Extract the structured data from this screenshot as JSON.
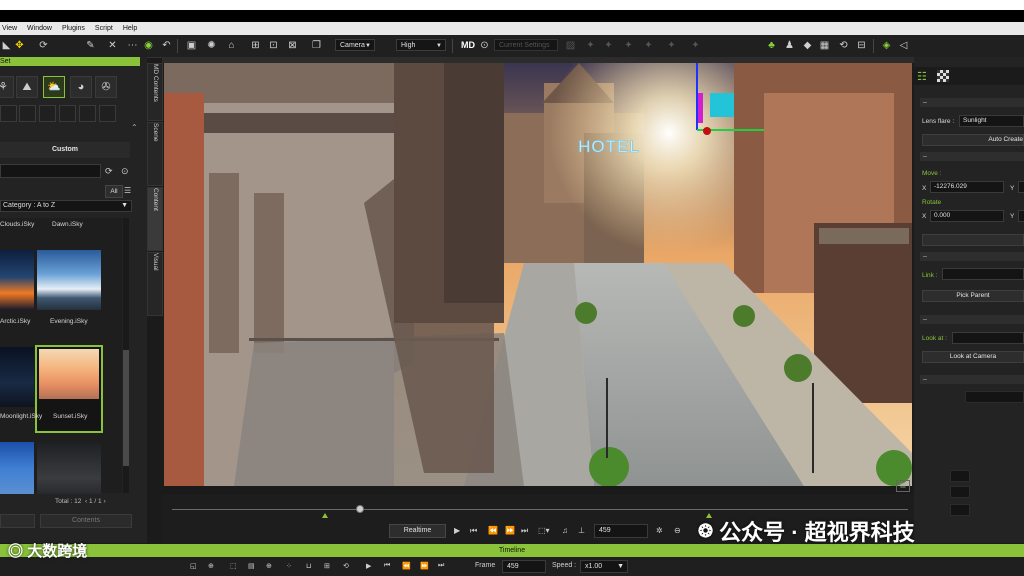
{
  "menu": [
    "View",
    "Window",
    "Plugins",
    "Script",
    "Help"
  ],
  "toolbar": {
    "camera_select": "Camera",
    "quality_select": "High",
    "ghost_select": "Current Settings"
  },
  "left_panel": {
    "header": "Set",
    "custom_label": "Custom",
    "all_label": "All",
    "category_select": "Category : A to Z",
    "items": [
      {
        "label": "Clouds.iSky"
      },
      {
        "label": "Dawn.iSky"
      },
      {
        "label": "Arctic.iSky"
      },
      {
        "label": "Evening.iSky"
      },
      {
        "label": "Moonlight.iSky"
      },
      {
        "label": "Sunset.iSky"
      }
    ],
    "total": "Total : 12",
    "page": "1 / 1",
    "btn_left": "",
    "btn_right": "Contents"
  },
  "side_tabs": [
    "MD Contents",
    "Scene",
    "Content",
    "Visual"
  ],
  "right_panel": {
    "lens_flare_label": "Lens flare :",
    "lens_flare_value": "Sunlight",
    "auto_create": "Auto Create",
    "move_label": "Move :",
    "move_x": "-12276.029",
    "rotate_label": "Rotate",
    "rotate_x": "0.000",
    "link_label": "Link :",
    "pick_parent": "Pick Parent",
    "look_at_label": "Look at :",
    "look_at_camera": "Look at Camera"
  },
  "viewport": {
    "sign": "HOTEL"
  },
  "transport": {
    "realtime": "Realtime",
    "frame_value": "459"
  },
  "timeline": {
    "title": "Timeline",
    "frame_label": "Frame",
    "frame_value": "459",
    "speed_label": "Speed :",
    "speed_value": "x1.00"
  },
  "watermark": {
    "text": "公众号 · 超视界科技",
    "logo_text": "大数跨境"
  },
  "colors": {
    "accent": "#8ac33a"
  }
}
